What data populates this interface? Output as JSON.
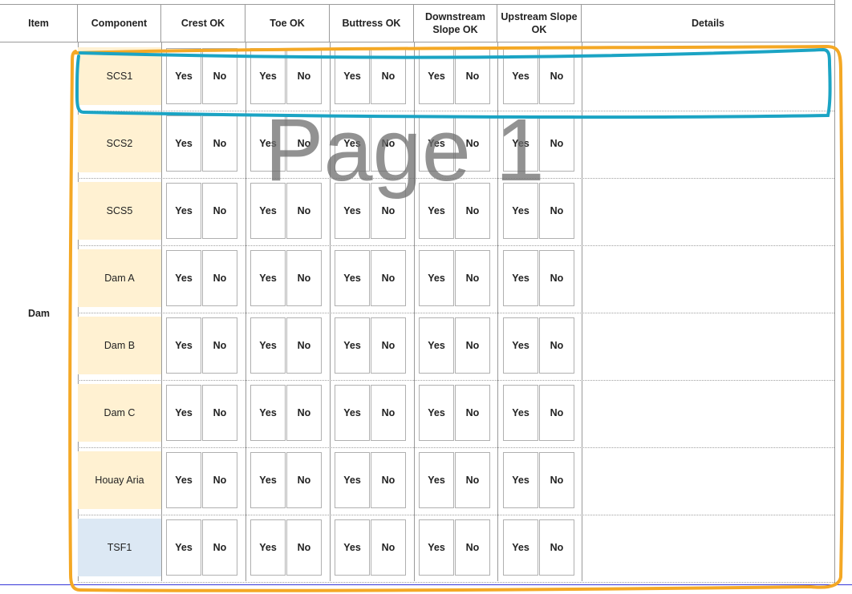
{
  "colors": {
    "dam_component_fill": "#fff1d2",
    "tsf_component_fill": "#dce8f4",
    "grid_line": "#9a9a9a",
    "annotation_orange": "#f4a825",
    "annotation_teal": "#1ba4c4",
    "page_bottom_line": "#3535d8",
    "watermark": "#777777"
  },
  "header": {
    "item": "Item",
    "component": "Component",
    "crest_ok": "Crest OK",
    "toe_ok": "Toe OK",
    "buttress_ok": "Buttress OK",
    "downstream_slope_ok": "Downstream Slope OK",
    "upstream_slope_ok": "Upstream Slope OK",
    "details": "Details"
  },
  "item_label": "Dam",
  "yes_label": "Yes",
  "no_label": "No",
  "rows": [
    {
      "component": "SCS1",
      "kind": "dam"
    },
    {
      "component": "SCS2",
      "kind": "dam"
    },
    {
      "component": "SCS5",
      "kind": "dam"
    },
    {
      "component": "Dam A",
      "kind": "dam"
    },
    {
      "component": "Dam B",
      "kind": "dam"
    },
    {
      "component": "Dam C",
      "kind": "dam"
    },
    {
      "component": "Houay Aria",
      "kind": "dam"
    },
    {
      "component": "TSF1",
      "kind": "tsf"
    }
  ],
  "watermark": "Page 1"
}
